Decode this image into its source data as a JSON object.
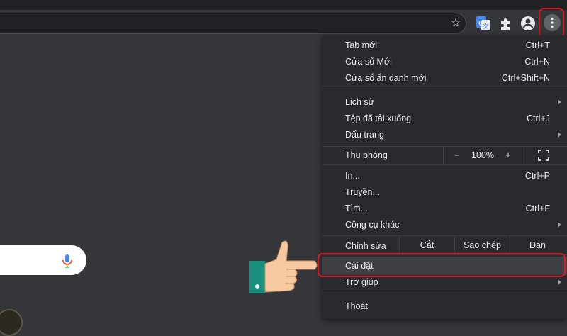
{
  "menu": {
    "items": [
      {
        "label": "Tab mới",
        "shortcut": "Ctrl+T"
      },
      {
        "label": "Cửa sổ Mới",
        "shortcut": "Ctrl+N"
      },
      {
        "label": "Cửa sổ ẩn danh mới",
        "shortcut": "Ctrl+Shift+N"
      },
      {
        "label": "Lịch sử",
        "shortcut": ""
      },
      {
        "label": "Tệp đã tải xuống",
        "shortcut": "Ctrl+J"
      },
      {
        "label": "Dấu trang",
        "shortcut": ""
      },
      {
        "label": "In...",
        "shortcut": "Ctrl+P"
      },
      {
        "label": "Truyền...",
        "shortcut": ""
      },
      {
        "label": "Tìm...",
        "shortcut": "Ctrl+F"
      },
      {
        "label": "Công cụ khác",
        "shortcut": ""
      },
      {
        "label": "Cài đặt",
        "shortcut": ""
      },
      {
        "label": "Trợ giúp",
        "shortcut": ""
      },
      {
        "label": "Thoát",
        "shortcut": ""
      }
    ],
    "zoom": {
      "label": "Thu phóng",
      "minus": "−",
      "value": "100%",
      "plus": "+"
    },
    "edit": {
      "label": "Chỉnh sửa",
      "cut": "Cắt",
      "copy": "Sao chép",
      "paste": "Dán"
    }
  },
  "colors": {
    "highlight": "#d71920",
    "menu_bg": "#292a2d",
    "accent_blue": "#4285f4"
  },
  "icons": [
    "star-icon",
    "translate-icon",
    "extensions-icon",
    "profile-icon",
    "more-vert-icon",
    "mic-icon",
    "fullscreen-icon",
    "pointing-hand-icon"
  ]
}
